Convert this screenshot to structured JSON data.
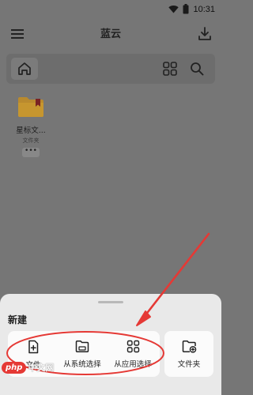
{
  "status_bar": {
    "time": "10:31",
    "icons": [
      "wifi-icon",
      "battery-icon"
    ]
  },
  "app_bar": {
    "title": "蓝云",
    "icons": [
      "menu-icon",
      "download-icon"
    ]
  },
  "toolbar": {
    "icons": [
      "home-icon",
      "grid-view-icon",
      "search-icon"
    ]
  },
  "files": [
    {
      "name": "星标文...",
      "type": "文件夹",
      "icon": "folder-star-icon"
    }
  ],
  "sheet": {
    "title": "新建",
    "options": [
      {
        "label": "文件",
        "icon": "new-file-icon"
      },
      {
        "label": "从系统选择",
        "icon": "system-folder-icon"
      },
      {
        "label": "从应用选择",
        "icon": "apps-grid-icon"
      },
      {
        "label": "文件夹",
        "icon": "new-folder-icon"
      }
    ]
  },
  "annotation": {
    "color": "#e53935"
  },
  "watermark": {
    "php": "php",
    "text": "中文网"
  }
}
